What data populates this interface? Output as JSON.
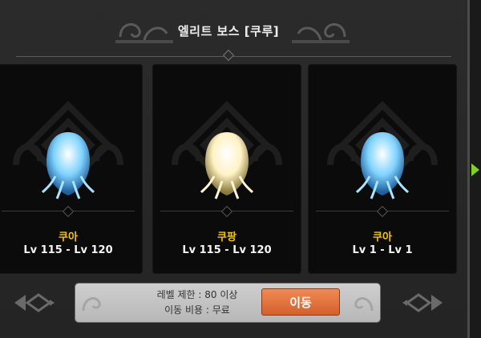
{
  "title": "엘리트 보스 [쿠루]",
  "cards": [
    {
      "name": "쿠아",
      "level_range": "Lv 115 - Lv 120",
      "tint": "#7fd3ff"
    },
    {
      "name": "쿠팡",
      "level_range": "Lv 115 - Lv 120",
      "tint": "#fff2c4"
    },
    {
      "name": "쿠아",
      "level_range": "Lv 1 - Lv 1",
      "tint": "#7fd3ff"
    }
  ],
  "info": {
    "level_limit": "레벨 제한 : 80 이상",
    "travel_cost": "이동 비용 : 무료"
  },
  "move_button": "이동",
  "colors": {
    "accent": "#e0733c",
    "name_gold": "#f2c500",
    "edge_arrow": "#7ed321"
  },
  "icons": [
    "prev-arrow-icon",
    "next-arrow-icon",
    "emblem-icon",
    "creature-icon",
    "edge-arrow-icon"
  ]
}
